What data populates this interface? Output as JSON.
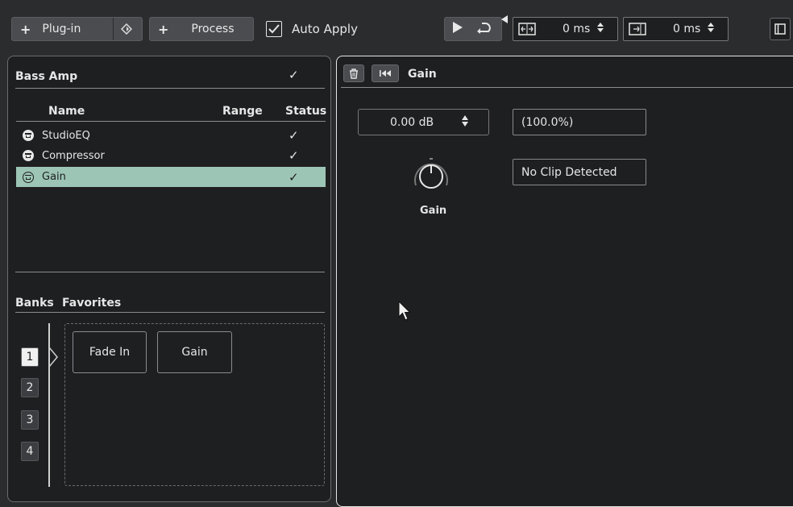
{
  "toolbar": {
    "plugin_label": "Plug-in",
    "process_label": "Process",
    "auto_apply_label": "Auto Apply",
    "auto_apply_checked": true,
    "pre_roll_value": "0 ms",
    "post_roll_value": "0 ms"
  },
  "left_panel": {
    "title": "Bass Amp",
    "columns": {
      "name": "Name",
      "range": "Range",
      "status": "Status"
    },
    "plugins": [
      {
        "name": "StudioEQ",
        "selected": false
      },
      {
        "name": "Compressor",
        "selected": false
      },
      {
        "name": "Gain",
        "selected": true
      }
    ],
    "banks_label": "Banks",
    "favorites_label": "Favorites",
    "bank_numbers": [
      "1",
      "2",
      "3",
      "4"
    ],
    "favorites": [
      "Fade In",
      "Gain"
    ]
  },
  "right_panel": {
    "title": "Gain",
    "gain_value": "0.00 dB",
    "percent_value": "(100.0%)",
    "clip_status": "No Clip Detected",
    "knob_label": "Gain"
  },
  "colors": {
    "selection": "#9dc5b6",
    "panel_bg": "#1e1f21",
    "toolbar_bg": "#2b2c2e"
  }
}
